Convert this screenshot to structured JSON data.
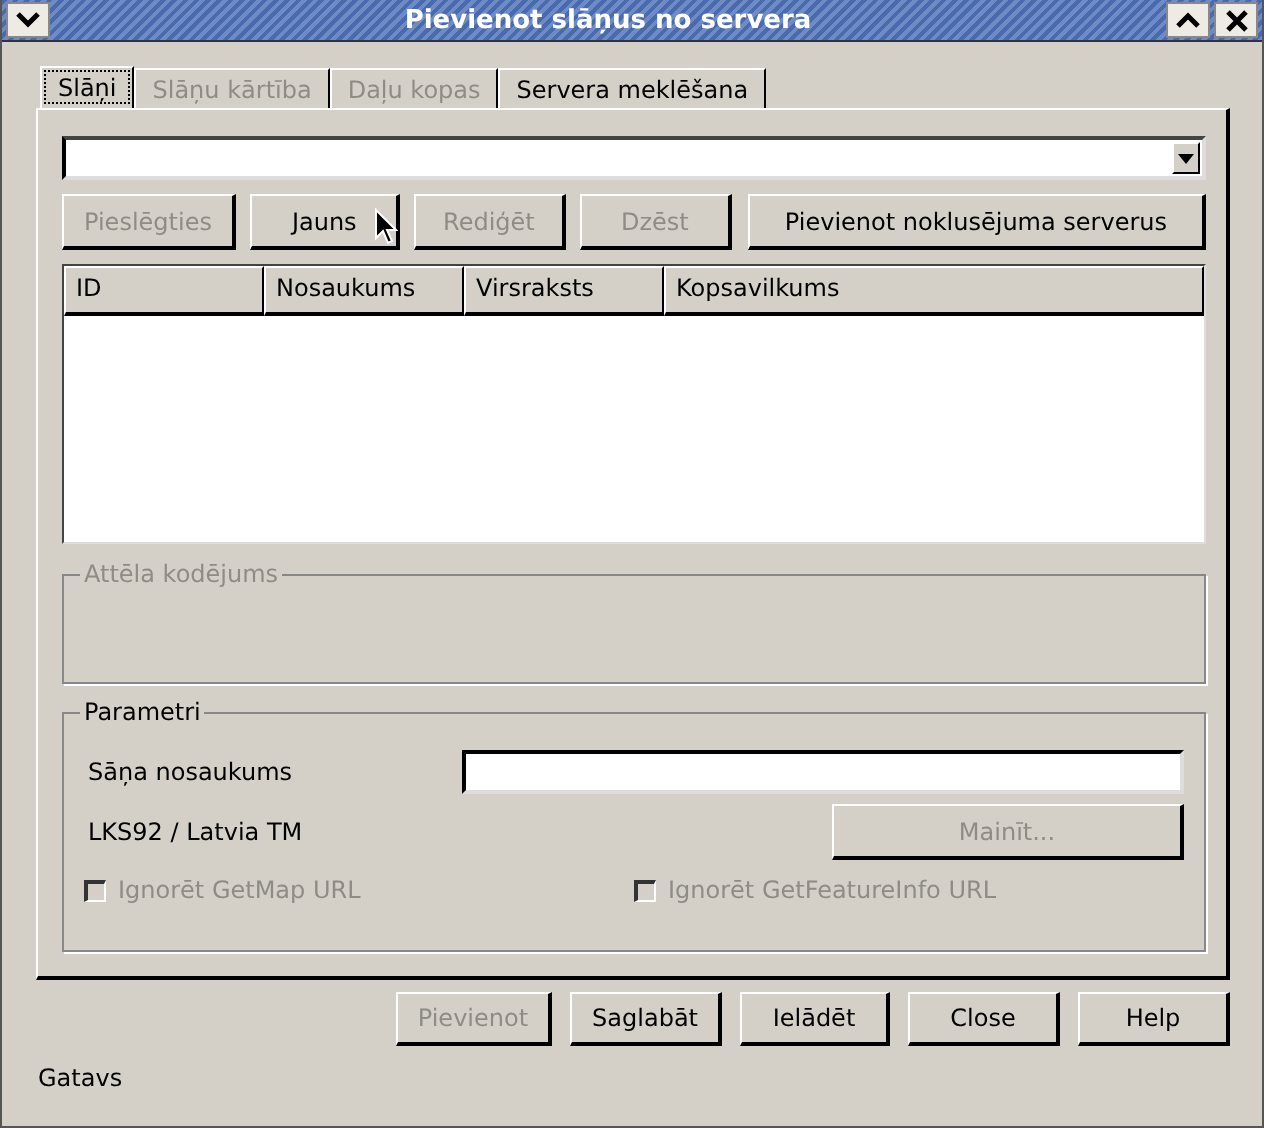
{
  "window": {
    "title": "Pievienot slāņus no servera"
  },
  "tabs": [
    {
      "label": "Slāņi",
      "selected": true,
      "disabled": false
    },
    {
      "label": "Slāņu kārtība",
      "selected": false,
      "disabled": true
    },
    {
      "label": "Daļu kopas",
      "selected": false,
      "disabled": true
    },
    {
      "label": "Servera meklēšana",
      "selected": false,
      "disabled": false
    }
  ],
  "server_buttons": [
    {
      "label": "Pieslēgties",
      "disabled": true
    },
    {
      "label": "Jauns",
      "disabled": false
    },
    {
      "label": "Rediģēt",
      "disabled": true
    },
    {
      "label": "Dzēst",
      "disabled": true
    },
    {
      "label": "Pievienot noklusējuma serverus",
      "disabled": false
    }
  ],
  "table": {
    "columns": [
      "ID",
      "Nosaukums",
      "Virsraksts",
      "Kopsavilkums"
    ]
  },
  "image_encoding": {
    "title": "Attēla kodējums",
    "disabled": true
  },
  "parameters": {
    "title": "Parametri",
    "layer_name_label": "Sāņa nosaukums",
    "crs": "LKS92 / Latvia TM",
    "change_button": {
      "label": "Mainīt...",
      "disabled": true
    },
    "checkboxes": [
      {
        "label": "Ignorēt GetMap URL",
        "checked": false,
        "disabled": true
      },
      {
        "label": "Ignorēt GetFeatureInfo URL",
        "checked": false,
        "disabled": true
      }
    ]
  },
  "dialog_buttons": [
    {
      "label": "Pievienot",
      "disabled": true
    },
    {
      "label": "Saglabāt",
      "disabled": false
    },
    {
      "label": "Ielādēt",
      "disabled": false
    },
    {
      "label": "Close",
      "disabled": false
    },
    {
      "label": "Help",
      "disabled": false
    }
  ],
  "status_bar": "Gatavs"
}
